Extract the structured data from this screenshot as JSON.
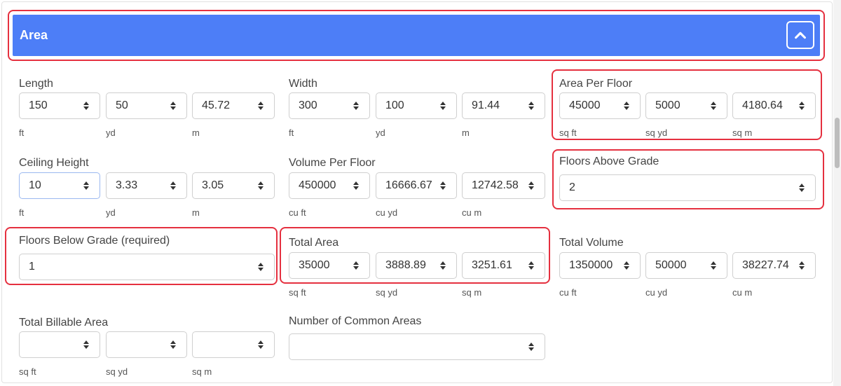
{
  "section": {
    "title": "Area"
  },
  "groups": [
    {
      "label": "Length",
      "values": [
        "150",
        "50",
        "45.72"
      ],
      "units": [
        "ft",
        "yd",
        "m"
      ]
    },
    {
      "label": "Width",
      "values": [
        "300",
        "100",
        "91.44"
      ],
      "units": [
        "ft",
        "yd",
        "m"
      ]
    },
    {
      "label": "Area Per Floor",
      "values": [
        "45000",
        "5000",
        "4180.64"
      ],
      "units": [
        "sq ft",
        "sq yd",
        "sq m"
      ]
    },
    {
      "label": "Ceiling Height",
      "values": [
        "10",
        "3.33",
        "3.05"
      ],
      "units": [
        "ft",
        "yd",
        "m"
      ]
    },
    {
      "label": "Volume Per Floor",
      "values": [
        "450000",
        "16666.67",
        "12742.58"
      ],
      "units": [
        "cu ft",
        "cu yd",
        "cu m"
      ]
    },
    {
      "label": "Floors Above Grade",
      "values": [
        "2"
      ]
    },
    {
      "label": "Floors Below Grade (required)",
      "values": [
        "1"
      ]
    },
    {
      "label": "Total Area",
      "values": [
        "35000",
        "3888.89",
        "3251.61"
      ],
      "units": [
        "sq ft",
        "sq yd",
        "sq m"
      ]
    },
    {
      "label": "Total Volume",
      "values": [
        "1350000",
        "50000",
        "38227.74"
      ],
      "units": [
        "cu ft",
        "cu yd",
        "cu m"
      ]
    },
    {
      "label": "Total Billable Area",
      "values": [
        "",
        "",
        ""
      ],
      "units": [
        "sq ft",
        "sq yd",
        "sq m"
      ]
    },
    {
      "label": "Number of Common Areas",
      "values": [
        ""
      ]
    }
  ],
  "colors": {
    "header": "#4d7ef7",
    "highlight": "#e5303f"
  }
}
